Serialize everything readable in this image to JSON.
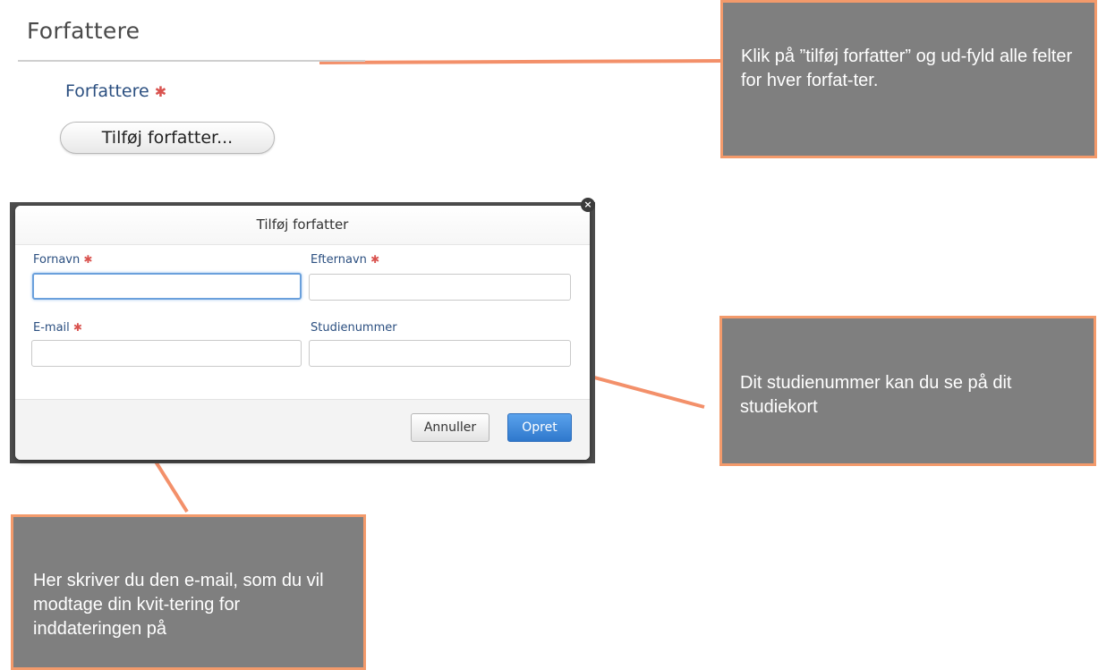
{
  "section": {
    "title": "Forfattere"
  },
  "authors_field": {
    "label": "Forfattere",
    "required_mark": "✱"
  },
  "add_button": {
    "label": "Tilføj forfatter..."
  },
  "dialog": {
    "title": "Tilføj forfatter",
    "close_glyph": "×",
    "fields": {
      "first_name": {
        "label": "Fornavn",
        "value": ""
      },
      "last_name": {
        "label": "Efternavn",
        "value": ""
      },
      "email": {
        "label": "E-mail",
        "value": ""
      },
      "student_number": {
        "label": "Studienummer",
        "value": ""
      }
    },
    "cancel_label": "Annuller",
    "ok_label": "Opret"
  },
  "callouts": {
    "add_author": "Klik på ”tilføj forfatter” og ud-fyld alle felter for hver forfat-ter.",
    "student_number": "Dit studienummer kan du se på dit studiekort",
    "email": "Her skriver du den e-mail, som du vil modtage din kvit-tering for inddateringen på"
  },
  "colors": {
    "callout_bg": "#7f7f7f",
    "callout_border": "#f39a6b",
    "connector": "#f3906a",
    "label_blue": "#2b4f80",
    "required_red": "#d9534f",
    "primary_button": "#2f78cc"
  }
}
